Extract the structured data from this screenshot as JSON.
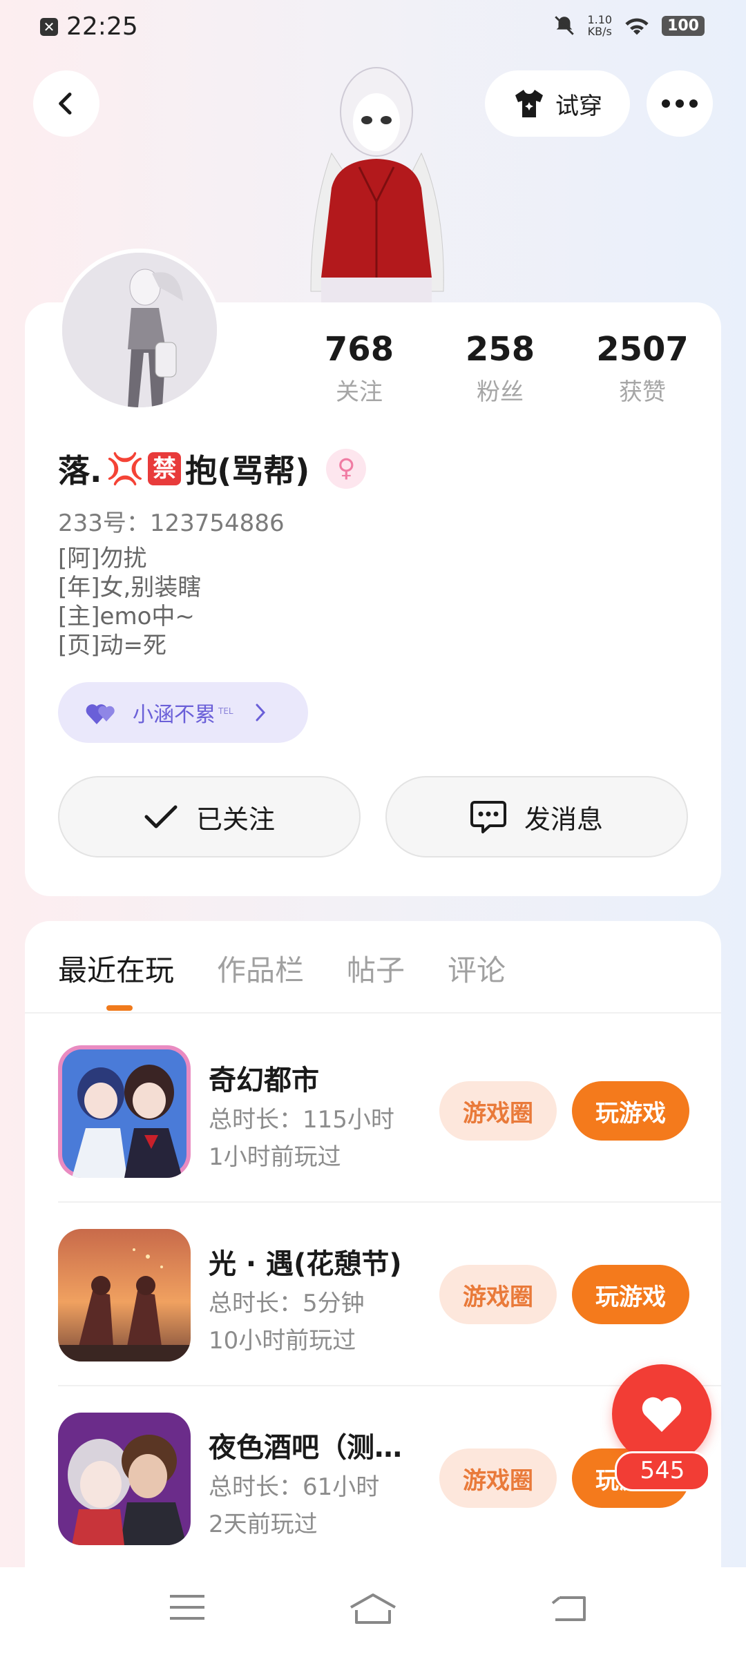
{
  "status_bar": {
    "time": "22:25",
    "net_speed_value": "1.10",
    "net_speed_unit": "KB/s",
    "battery": "100"
  },
  "header": {
    "tryon_label": "试穿"
  },
  "stats": [
    {
      "value": "768",
      "label": "关注"
    },
    {
      "value": "258",
      "label": "粉丝"
    },
    {
      "value": "2507",
      "label": "获赞"
    }
  ],
  "profile": {
    "name_prefix": "落.",
    "name_badge": "禁",
    "name_suffix": "抱(骂帮)",
    "uid": "233号：123754886",
    "bio": "[阿]勿扰\n[年]女,别装瞎\n[主]emo中~\n[页]动=死",
    "tag_label": "小涵不累",
    "tag_sup": "TEL"
  },
  "actions": {
    "follow_label": "已关注",
    "message_label": "发消息"
  },
  "tabs": [
    "最近在玩",
    "作品栏",
    "帖子",
    "评论"
  ],
  "games": [
    {
      "title": "奇幻都市",
      "duration": "总时长：115小时",
      "last_played": "1小时前玩过",
      "circle_label": "游戏圈",
      "play_label": "玩游戏"
    },
    {
      "title": "光 · 遇(花憩节)",
      "duration": "总时长：5分钟",
      "last_played": "10小时前玩过",
      "circle_label": "游戏圈",
      "play_label": "玩游戏"
    },
    {
      "title": "夜色酒吧（测…",
      "duration": "总时长：61小时",
      "last_played": "2天前玩过",
      "circle_label": "游戏圈",
      "play_label": "玩游戏"
    }
  ],
  "like_count": "545",
  "colors": {
    "accent_orange": "#f47a1c",
    "like_red": "#f23d35",
    "tag_purple": "#6a5fd8"
  }
}
